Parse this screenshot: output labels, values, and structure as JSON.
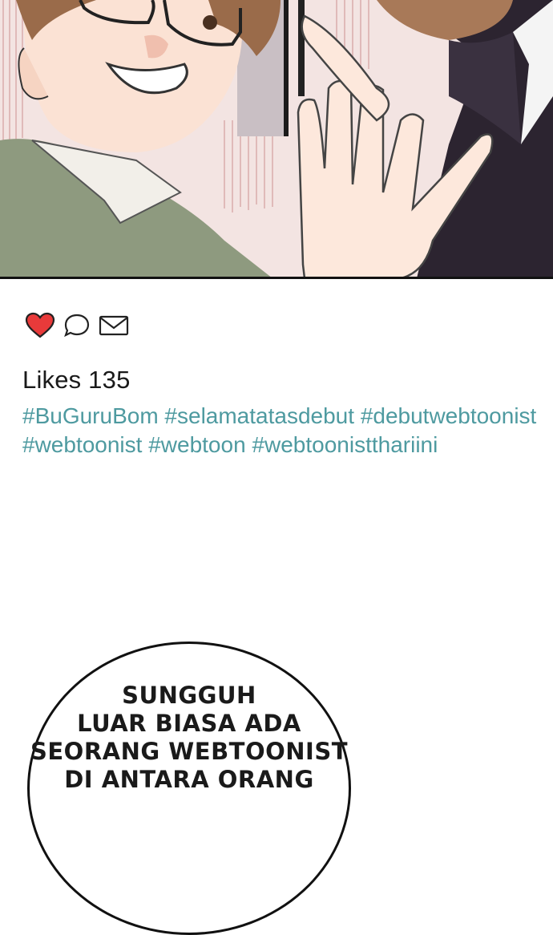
{
  "illustration": {
    "description_icon": "comic-panel-characters"
  },
  "post": {
    "icons": [
      "heart-icon",
      "comment-icon",
      "message-icon"
    ],
    "heart_color": "#e83a3a",
    "likes_text": "Likes 135",
    "hashtags": [
      "#BuGuruBom",
      "#selamatatasdebut",
      "#debutwebtoonist",
      "#webtoonist",
      "#webtoon",
      "#webtoonistthariini"
    ],
    "hashtag_color": "#4e9aa0"
  },
  "speech_bubble": {
    "lines": [
      "SUNGGUH",
      "LUAR BIASA ADA",
      "SEORANG WEBTOONIST",
      "DI ANTARA ORANG"
    ]
  }
}
